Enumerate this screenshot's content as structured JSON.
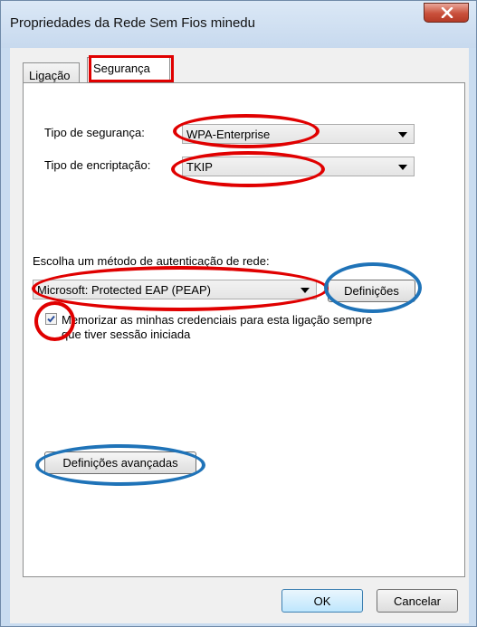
{
  "window": {
    "title": "Propriedades da Rede Sem Fios minedu"
  },
  "tabs": [
    {
      "label": "Ligação",
      "selected": false
    },
    {
      "label": "Segurança",
      "selected": true
    }
  ],
  "security": {
    "type_label": "Tipo de segurança:",
    "type_value": "WPA-Enterprise",
    "encryption_label": "Tipo de encriptação:",
    "encryption_value": "TKIP",
    "auth_method_label": "Escolha um método de autenticação de rede:",
    "auth_method_value": "Microsoft: Protected EAP (PEAP)",
    "settings_button": "Definições",
    "remember_credentials_line1": "Memorizar as minhas credenciais para esta ligação sempre",
    "remember_credentials_line2": "que tiver sessão iniciada",
    "remember_credentials_checked": true,
    "advanced_settings_button": "Definições avançadas"
  },
  "footer": {
    "ok_button": "OK",
    "cancel_button": "Cancelar"
  },
  "colors": {
    "highlight_red": "#e00000",
    "highlight_blue": "#1f73b8",
    "close_button": "#c9503b"
  }
}
